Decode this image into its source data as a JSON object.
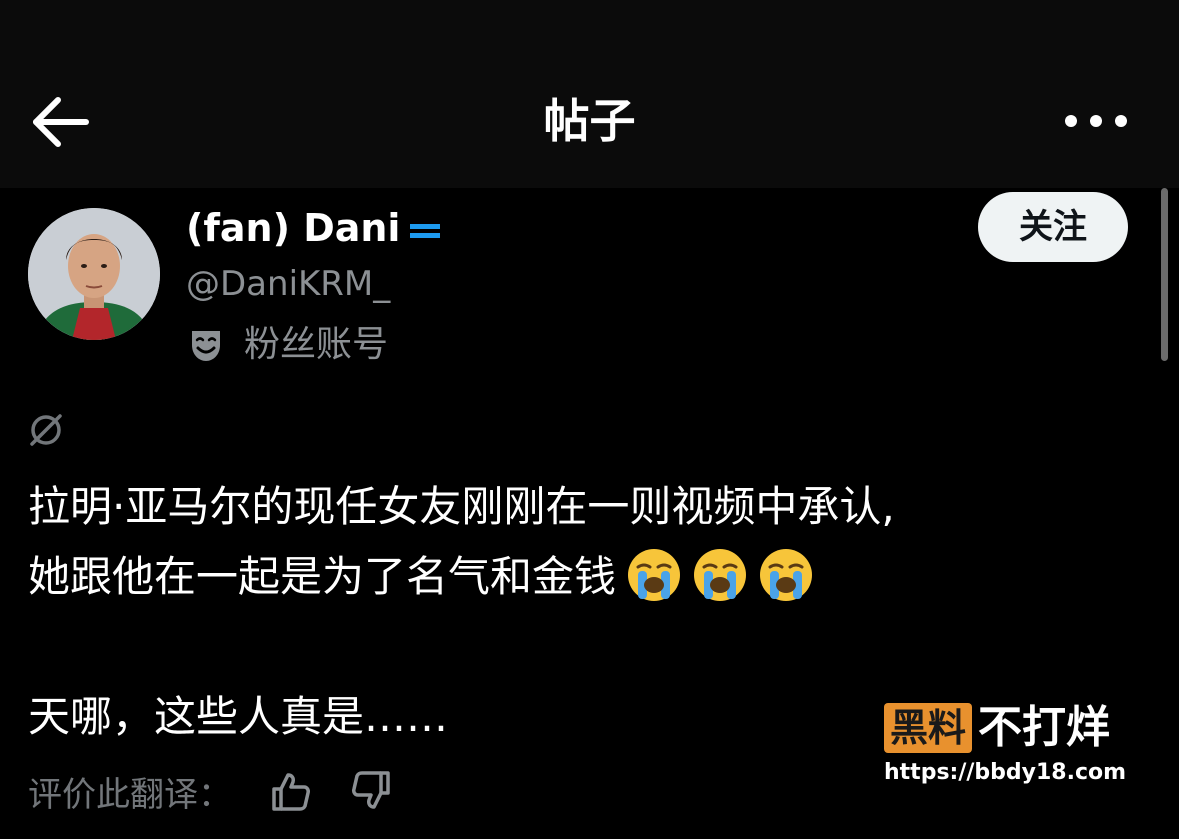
{
  "header": {
    "title": "帖子",
    "back_icon": "arrow-left-icon",
    "more_icon": "more-horizontal-icon"
  },
  "author": {
    "display_name": "(fan) Dani",
    "handle": "@DaniKRM_",
    "account_type_label": "粉丝账号",
    "account_type_icon": "theater-mask-icon",
    "verified_color": "#1d9bf0"
  },
  "follow_button": {
    "label": "关注"
  },
  "post": {
    "lines": [
      "拉明·亚马尔的现任女友刚刚在一则视频中承认,",
      "她跟他在一起是为了名气和金钱"
    ],
    "emoji": [
      "loudly-crying-face",
      "loudly-crying-face",
      "loudly-crying-face"
    ],
    "second_paragraph": "天哪，这些人真是……"
  },
  "translation_rating": {
    "label": "评价此翻译：",
    "like_icon": "thumbs-up-icon",
    "dislike_icon": "thumbs-down-icon"
  },
  "watermark": {
    "brand_box": "黑料",
    "brand_rest": "不打烊",
    "url": "https://bbdy18.com",
    "box_color": "#e8912e"
  },
  "colors": {
    "background": "#000000",
    "header_background": "#0b0b0b",
    "secondary_text": "#8c9094",
    "follow_button_bg": "#eff3f4"
  }
}
